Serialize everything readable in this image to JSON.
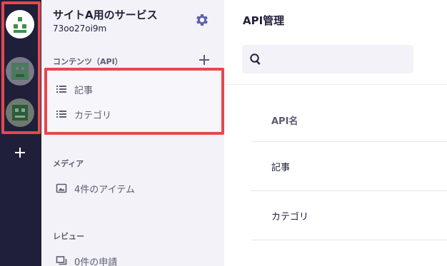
{
  "rail": {
    "avatars": [
      {
        "name": "service-a-avatar",
        "bg": "#ffffff",
        "fg": "#3a8f4a"
      },
      {
        "name": "service-b-avatar",
        "bg": "#7a7a88",
        "fg": "#3f6f52"
      },
      {
        "name": "service-c-avatar",
        "bg": "#6f7a6f",
        "fg": "#2f5a3a"
      }
    ],
    "add_icon": "plus-icon",
    "highlight_color": "#e5484d"
  },
  "sidebar": {
    "service_title": "サイトA用のサービス",
    "service_id": "73oo27oi9m",
    "settings_icon": "gear-icon",
    "content_section": {
      "label": "コンテンツ（API）",
      "add_icon": "plus-icon",
      "items": [
        {
          "label": "記事",
          "icon": "list-icon"
        },
        {
          "label": "カテゴリ",
          "icon": "list-icon"
        }
      ]
    },
    "media_section": {
      "label": "メディア",
      "item": {
        "label": "4件のアイテム",
        "icon": "image-icon"
      }
    },
    "review_section": {
      "label": "レビュー",
      "item": {
        "label": "0件の申請",
        "icon": "review-icon"
      }
    }
  },
  "main": {
    "title": "API管理",
    "search": {
      "placeholder": "",
      "icon": "search-icon"
    },
    "table": {
      "header": "API名",
      "rows": [
        "記事",
        "カテゴリ"
      ]
    }
  },
  "colors": {
    "rail_bg": "#1f1f3a",
    "sidebar_bg": "#f2f2f8",
    "highlight": "#e5484d",
    "accent": "#5a5fb0"
  }
}
